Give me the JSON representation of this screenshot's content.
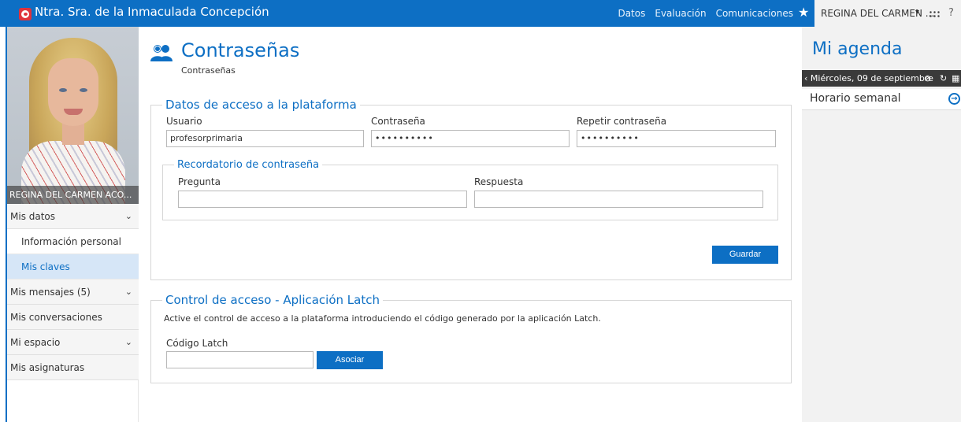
{
  "header": {
    "school_name": "Ntra. Sra. de la Inmaculada Concepción",
    "nav": [
      "Datos",
      "Evaluación",
      "Comunicaciones"
    ],
    "user_name": "REGINA DEL CARMEN ...",
    "icons": {
      "logo": "school-logo-icon",
      "favorite": "star-icon",
      "apps": "grid-icon",
      "help": "help-icon"
    }
  },
  "sidebar": {
    "profile_caption": "REGINA DEL CARMEN ACO...",
    "menu": {
      "mis_datos": "Mis datos",
      "informacion_personal": "Información personal",
      "mis_claves": "Mis claves",
      "mis_mensajes": "Mis mensajes (5)",
      "mis_conversaciones": "Mis conversaciones",
      "mi_espacio": "Mi espacio",
      "mis_asignaturas": "Mis asignaturas"
    },
    "active_item": "Mis claves"
  },
  "page": {
    "title": "Contraseñas",
    "subtitle": "Contraseñas"
  },
  "access": {
    "legend": "Datos de acceso a la plataforma",
    "usuario_label": "Usuario",
    "usuario_value": "profesorprimaria",
    "password_label": "Contraseña",
    "password_value": "••••••••••",
    "repeat_label": "Repetir contraseña",
    "repeat_value": "••••••••••",
    "reminder": {
      "legend": "Recordatorio de contraseña",
      "question_label": "Pregunta",
      "question_value": "",
      "answer_label": "Respuesta",
      "answer_value": ""
    },
    "save_label": "Guardar"
  },
  "latch": {
    "legend": "Control de acceso - Aplicación Latch",
    "description": "Active el control de acceso a la plataforma introduciendo el código generado por la aplicación Latch.",
    "code_label": "Código Latch",
    "code_value": "",
    "associate_label": "Asociar"
  },
  "agenda": {
    "title": "Mi agenda",
    "date": "Miércoles, 09 de septiembre",
    "weekly_schedule": "Horario semanal"
  },
  "colors": {
    "primary": "#0d6fc4",
    "active_bg": "#d6e6f7",
    "agenda_bg": "#f2f2f2"
  }
}
